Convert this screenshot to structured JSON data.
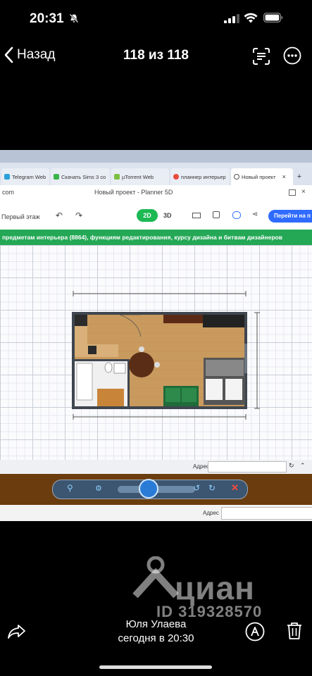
{
  "status": {
    "time": "20:31"
  },
  "nav": {
    "back_label": "Назад",
    "counter": "118 из 118"
  },
  "photo": {
    "tabs": [
      "Telegram Web",
      "Скачать Sims 3 co",
      "µTorrent Web",
      "планнер интерьер",
      "Новый проект"
    ],
    "window_title": "Новый проект - Planner 5D",
    "url_fragment": "com",
    "floor_label": "Первый этаж",
    "btn_2d": "2D",
    "btn_3d": "3D",
    "cta": "Перейти на п",
    "banner": "предметам интерьера (8864), функциям редактирования, курсу дизайна и битвам дизайнеров",
    "address_label": "Адрес",
    "address_label_2": "Адрес"
  },
  "watermark": {
    "brand": "циан",
    "id": "ID 319328570"
  },
  "footer": {
    "author": "Юля Улаева",
    "date": "сегодня в 20:30"
  },
  "colors": {
    "banner": "#24a856",
    "taskbar": "#6b3c0e",
    "cta": "#2f6bff",
    "btn_2d": "#1db954"
  }
}
